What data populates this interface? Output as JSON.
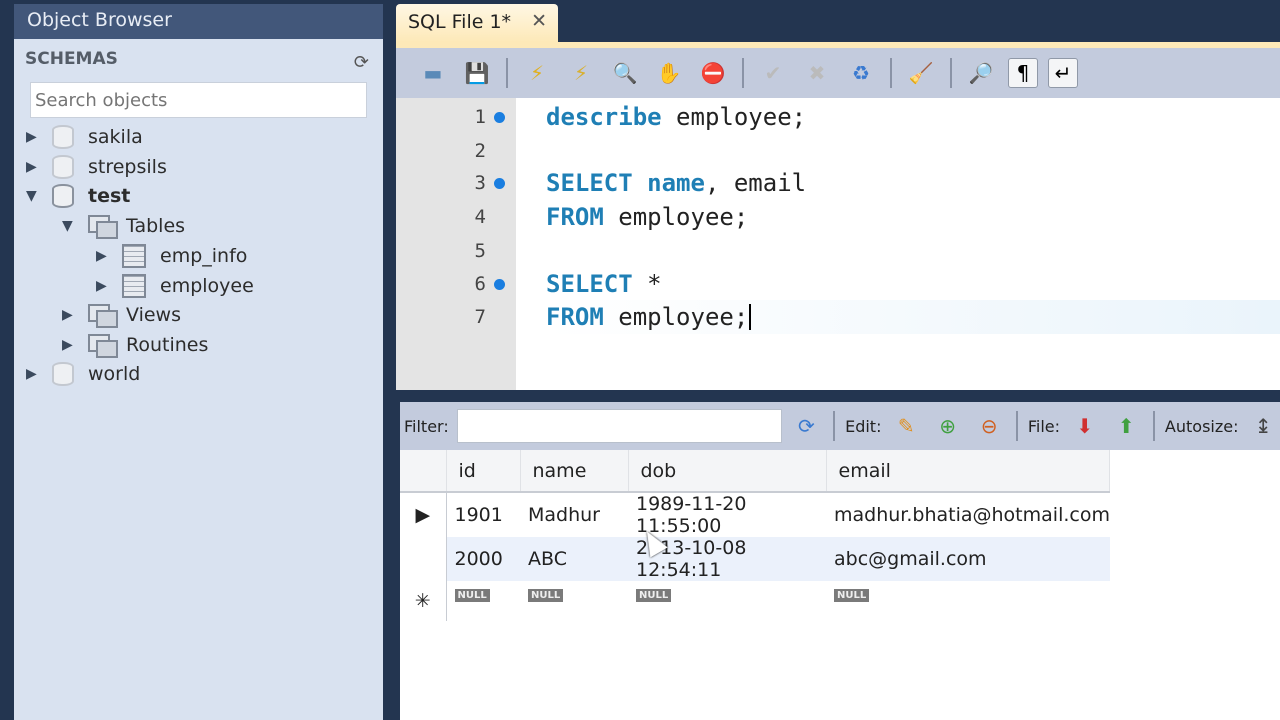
{
  "sidebar": {
    "title": "Object Browser",
    "schemas_label": "SCHEMAS",
    "search_placeholder": "Search objects",
    "tree": {
      "sakila": "sakila",
      "strepsils": "strepsils",
      "test": "test",
      "tables": "Tables",
      "emp_info": "emp_info",
      "employee": "employee",
      "views": "Views",
      "routines": "Routines",
      "world": "world"
    }
  },
  "tab": {
    "label": "SQL File 1*",
    "close": "✕"
  },
  "editor": {
    "lines": [
      {
        "num": "1",
        "kw": "describe",
        "rest": " employee;",
        "marker": true
      },
      {
        "num": "2",
        "kw": "",
        "rest": "",
        "marker": false
      },
      {
        "num": "3",
        "kw": "SELECT name",
        "rest": ", email",
        "marker": true
      },
      {
        "num": "4",
        "kw": "FROM",
        "rest": " employee;",
        "marker": false
      },
      {
        "num": "5",
        "kw": "",
        "rest": "",
        "marker": false
      },
      {
        "num": "6",
        "kw": "SELECT",
        "rest": " *",
        "marker": true
      },
      {
        "num": "7",
        "kw": "FROM",
        "rest": " employee;",
        "marker": false
      }
    ]
  },
  "results": {
    "filter_label": "Filter:",
    "filter_value": "",
    "edit_label": "Edit:",
    "file_label": "File:",
    "autosize_label": "Autosize:",
    "columns": [
      "id",
      "name",
      "dob",
      "email"
    ],
    "rows": [
      [
        "1901",
        "Madhur",
        "1989-11-20 11:55:00",
        "madhur.bhatia@hotmail.com"
      ],
      [
        "2000",
        "ABC",
        "2013-10-08 12:54:11",
        "abc@gmail.com"
      ]
    ],
    "null_label": "NULL",
    "new_row_marker": "✳",
    "current_row_marker": "▶"
  }
}
